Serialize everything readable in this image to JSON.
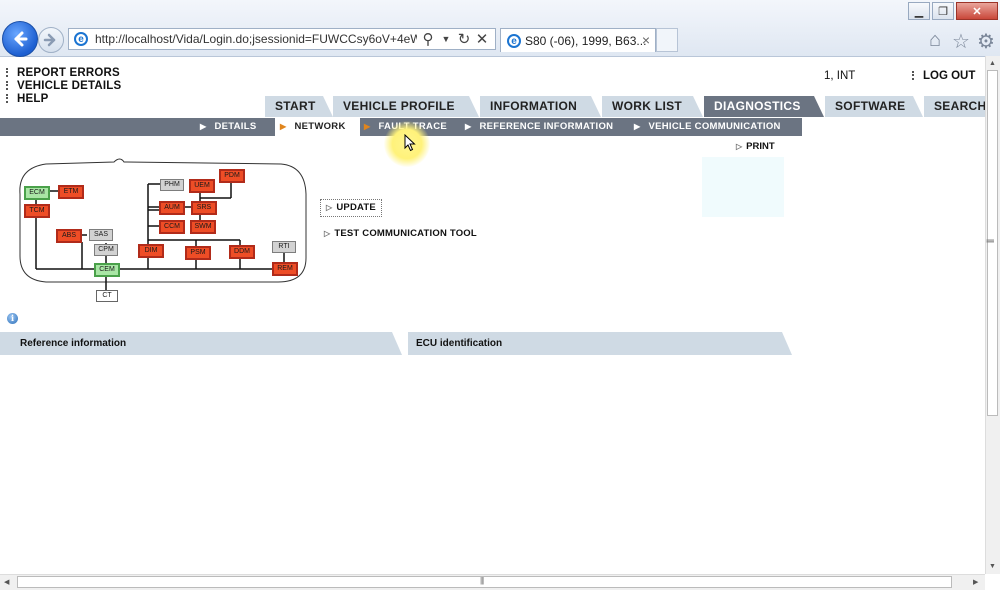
{
  "browser": {
    "url": "http://localhost/Vida/Login.do;jsessionid=FUWCCsy6oV+4eW",
    "tab_title": "S80 (-06), 1999, B63...",
    "tab_close": "×",
    "icons": [
      "back-arrow-icon",
      "forward-arrow-icon",
      "ie-logo-icon",
      "search-icon",
      "dropdown-icon",
      "refresh-icon",
      "stop-icon",
      "home-icon",
      "favorites-star-icon",
      "settings-gear-icon"
    ]
  },
  "page": {
    "top_links": [
      "REPORT ERRORS",
      "VEHICLE DETAILS",
      "HELP"
    ],
    "user_id": "1, INT",
    "logout": "LOG OUT",
    "main_tabs": [
      "START",
      "VEHICLE PROFILE",
      "INFORMATION",
      "WORK LIST",
      "DIAGNOSTICS",
      "SOFTWARE",
      "SEARCH"
    ],
    "active_main_tab": "DIAGNOSTICS",
    "sub_tabs": [
      "DETAILS",
      "NETWORK",
      "FAULT TRACE",
      "REFERENCE INFORMATION",
      "VEHICLE COMMUNICATION"
    ],
    "active_sub_tab": "NETWORK",
    "print": "PRINT",
    "update": "UPDATE",
    "test_comm": "TEST COMMUNICATION TOOL",
    "info_icon": "i",
    "panels": [
      "Reference information",
      "ECU identification"
    ]
  },
  "network_diagram": {
    "status_colors": {
      "fault": "#ee4d26",
      "ok": "#a9e6a5",
      "not_available": "#d2d2d2",
      "plain": "#ffffff"
    },
    "ecus": {
      "ecm": {
        "label": "ECM",
        "status": "ok"
      },
      "etm": {
        "label": "ETM",
        "status": "fault"
      },
      "tcm": {
        "label": "TCM",
        "status": "fault"
      },
      "abs": {
        "label": "ABS",
        "status": "fault"
      },
      "sas": {
        "label": "SAS",
        "status": "not_available"
      },
      "cpm": {
        "label": "CPM",
        "status": "not_available"
      },
      "cem": {
        "label": "CEM",
        "status": "ok"
      },
      "ct": {
        "label": "CT",
        "status": "plain"
      },
      "phm": {
        "label": "PHM",
        "status": "not_available"
      },
      "uem": {
        "label": "UEM",
        "status": "fault"
      },
      "pdm": {
        "label": "PDM",
        "status": "fault"
      },
      "aum": {
        "label": "AUM",
        "status": "fault"
      },
      "srs": {
        "label": "SRS",
        "status": "fault"
      },
      "ccm": {
        "label": "CCM",
        "status": "fault"
      },
      "swm": {
        "label": "SWM",
        "status": "fault"
      },
      "dim": {
        "label": "DIM",
        "status": "fault"
      },
      "psm": {
        "label": "PSM",
        "status": "fault"
      },
      "ddm": {
        "label": "DDM",
        "status": "fault"
      },
      "rti": {
        "label": "RTI",
        "status": "not_available"
      },
      "rem": {
        "label": "REM",
        "status": "fault"
      }
    }
  }
}
